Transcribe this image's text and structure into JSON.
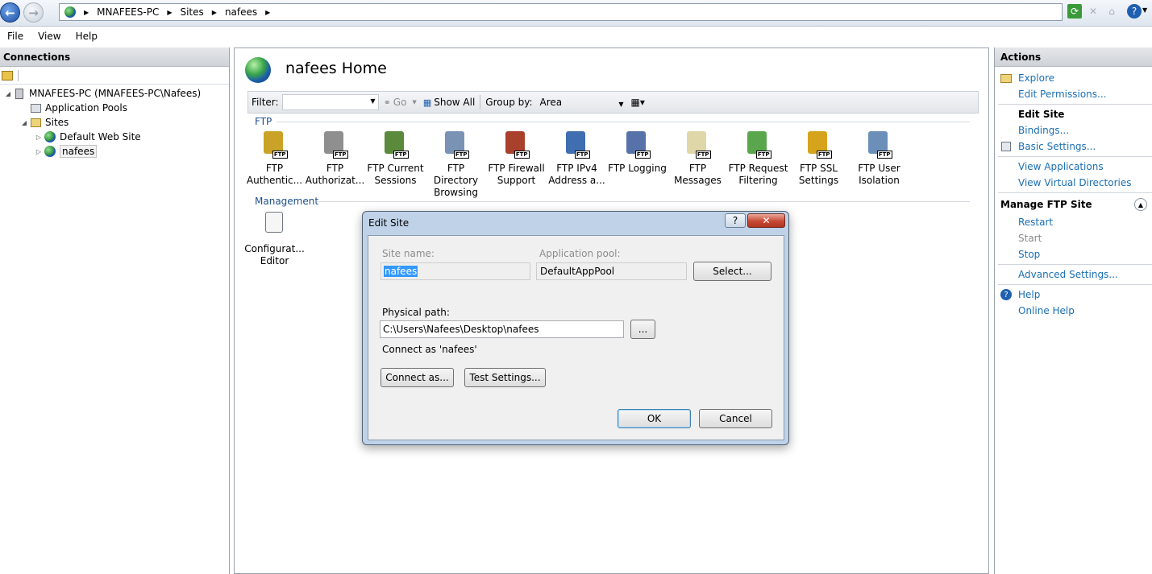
{
  "address": {
    "crumbs": [
      "MNAFEES-PC",
      "Sites",
      "nafees"
    ]
  },
  "menu": [
    "File",
    "View",
    "Help"
  ],
  "connections": {
    "title": "Connections",
    "tree": [
      {
        "label": "MNAFEES-PC (MNAFEES-PC\\Nafees)",
        "icon": "server-icon",
        "expander": "◢"
      },
      {
        "label": "Application Pools",
        "icon": "app-pool-icon",
        "expander": ""
      },
      {
        "label": "Sites",
        "icon": "sites-folder-icon",
        "expander": "◢"
      },
      {
        "label": "Default Web Site",
        "icon": "globe-icon",
        "expander": "▷"
      },
      {
        "label": "nafees",
        "icon": "globe-icon",
        "expander": "▷"
      }
    ]
  },
  "center": {
    "title": "nafees Home",
    "filter": {
      "label": "Filter:",
      "value": "",
      "go": "Go",
      "show_all": "Show All",
      "group_by_label": "Group by:",
      "group_by_value": "Area"
    },
    "ftp_section": "FTP",
    "features": [
      {
        "line1": "FTP",
        "line2": "Authentic...",
        "color": "#c9a227",
        "icon": "ftp-authentication-icon"
      },
      {
        "line1": "FTP",
        "line2": "Authorizat...",
        "color": "#8f8f8f",
        "icon": "ftp-authorization-icon"
      },
      {
        "line1": "FTP Current",
        "line2": "Sessions",
        "color": "#5b8a3c",
        "icon": "ftp-sessions-icon"
      },
      {
        "line1": "FTP Directory",
        "line2": "Browsing",
        "color": "#7a93b5",
        "icon": "ftp-directory-icon"
      },
      {
        "line1": "FTP Firewall",
        "line2": "Support",
        "color": "#a8402c",
        "icon": "ftp-firewall-icon"
      },
      {
        "line1": "FTP IPv4",
        "line2": "Address a...",
        "color": "#3f6fb0",
        "icon": "ftp-ipv4-icon"
      },
      {
        "line1": "FTP Logging",
        "line2": "",
        "color": "#5672a8",
        "icon": "ftp-logging-icon"
      },
      {
        "line1": "FTP",
        "line2": "Messages",
        "color": "#e0d7a8",
        "icon": "ftp-messages-icon"
      },
      {
        "line1": "FTP Request",
        "line2": "Filtering",
        "color": "#5aa64c",
        "icon": "ftp-request-filtering-icon"
      },
      {
        "line1": "FTP SSL",
        "line2": "Settings",
        "color": "#d6a31c",
        "icon": "ftp-ssl-icon"
      },
      {
        "line1": "FTP User",
        "line2": "Isolation",
        "color": "#6b8fb8",
        "icon": "ftp-user-isolation-icon"
      }
    ],
    "management_section": "Management",
    "management_features": [
      {
        "line1": "Configurat...",
        "line2": "Editor",
        "icon": "configuration-editor-icon"
      }
    ]
  },
  "actions": {
    "title": "Actions",
    "explore": "Explore",
    "edit_permissions": "Edit Permissions...",
    "edit_site": "Edit Site",
    "bindings": "Bindings...",
    "basic_settings": "Basic Settings...",
    "view_applications": "View Applications",
    "view_virtual_directories": "View Virtual Directories",
    "manage_ftp_site": "Manage FTP Site",
    "restart": "Restart",
    "start": "Start",
    "stop": "Stop",
    "advanced_settings": "Advanced Settings...",
    "help": "Help",
    "online_help": "Online Help"
  },
  "dialog": {
    "title": "Edit Site",
    "help_glyph": "?",
    "close_glyph": "✕",
    "site_name_label": "Site name:",
    "site_name_value": "nafees",
    "app_pool_label": "Application pool:",
    "app_pool_value": "DefaultAppPool",
    "select_button": "Select...",
    "physical_path_label": "Physical path:",
    "physical_path_value": "C:\\Users\\Nafees\\Desktop\\nafees",
    "browse_button": "...",
    "connect_as_text": "Connect as 'nafees'",
    "connect_as_button": "Connect as...",
    "test_settings_button": "Test Settings...",
    "ok_button": "OK",
    "cancel_button": "Cancel"
  }
}
